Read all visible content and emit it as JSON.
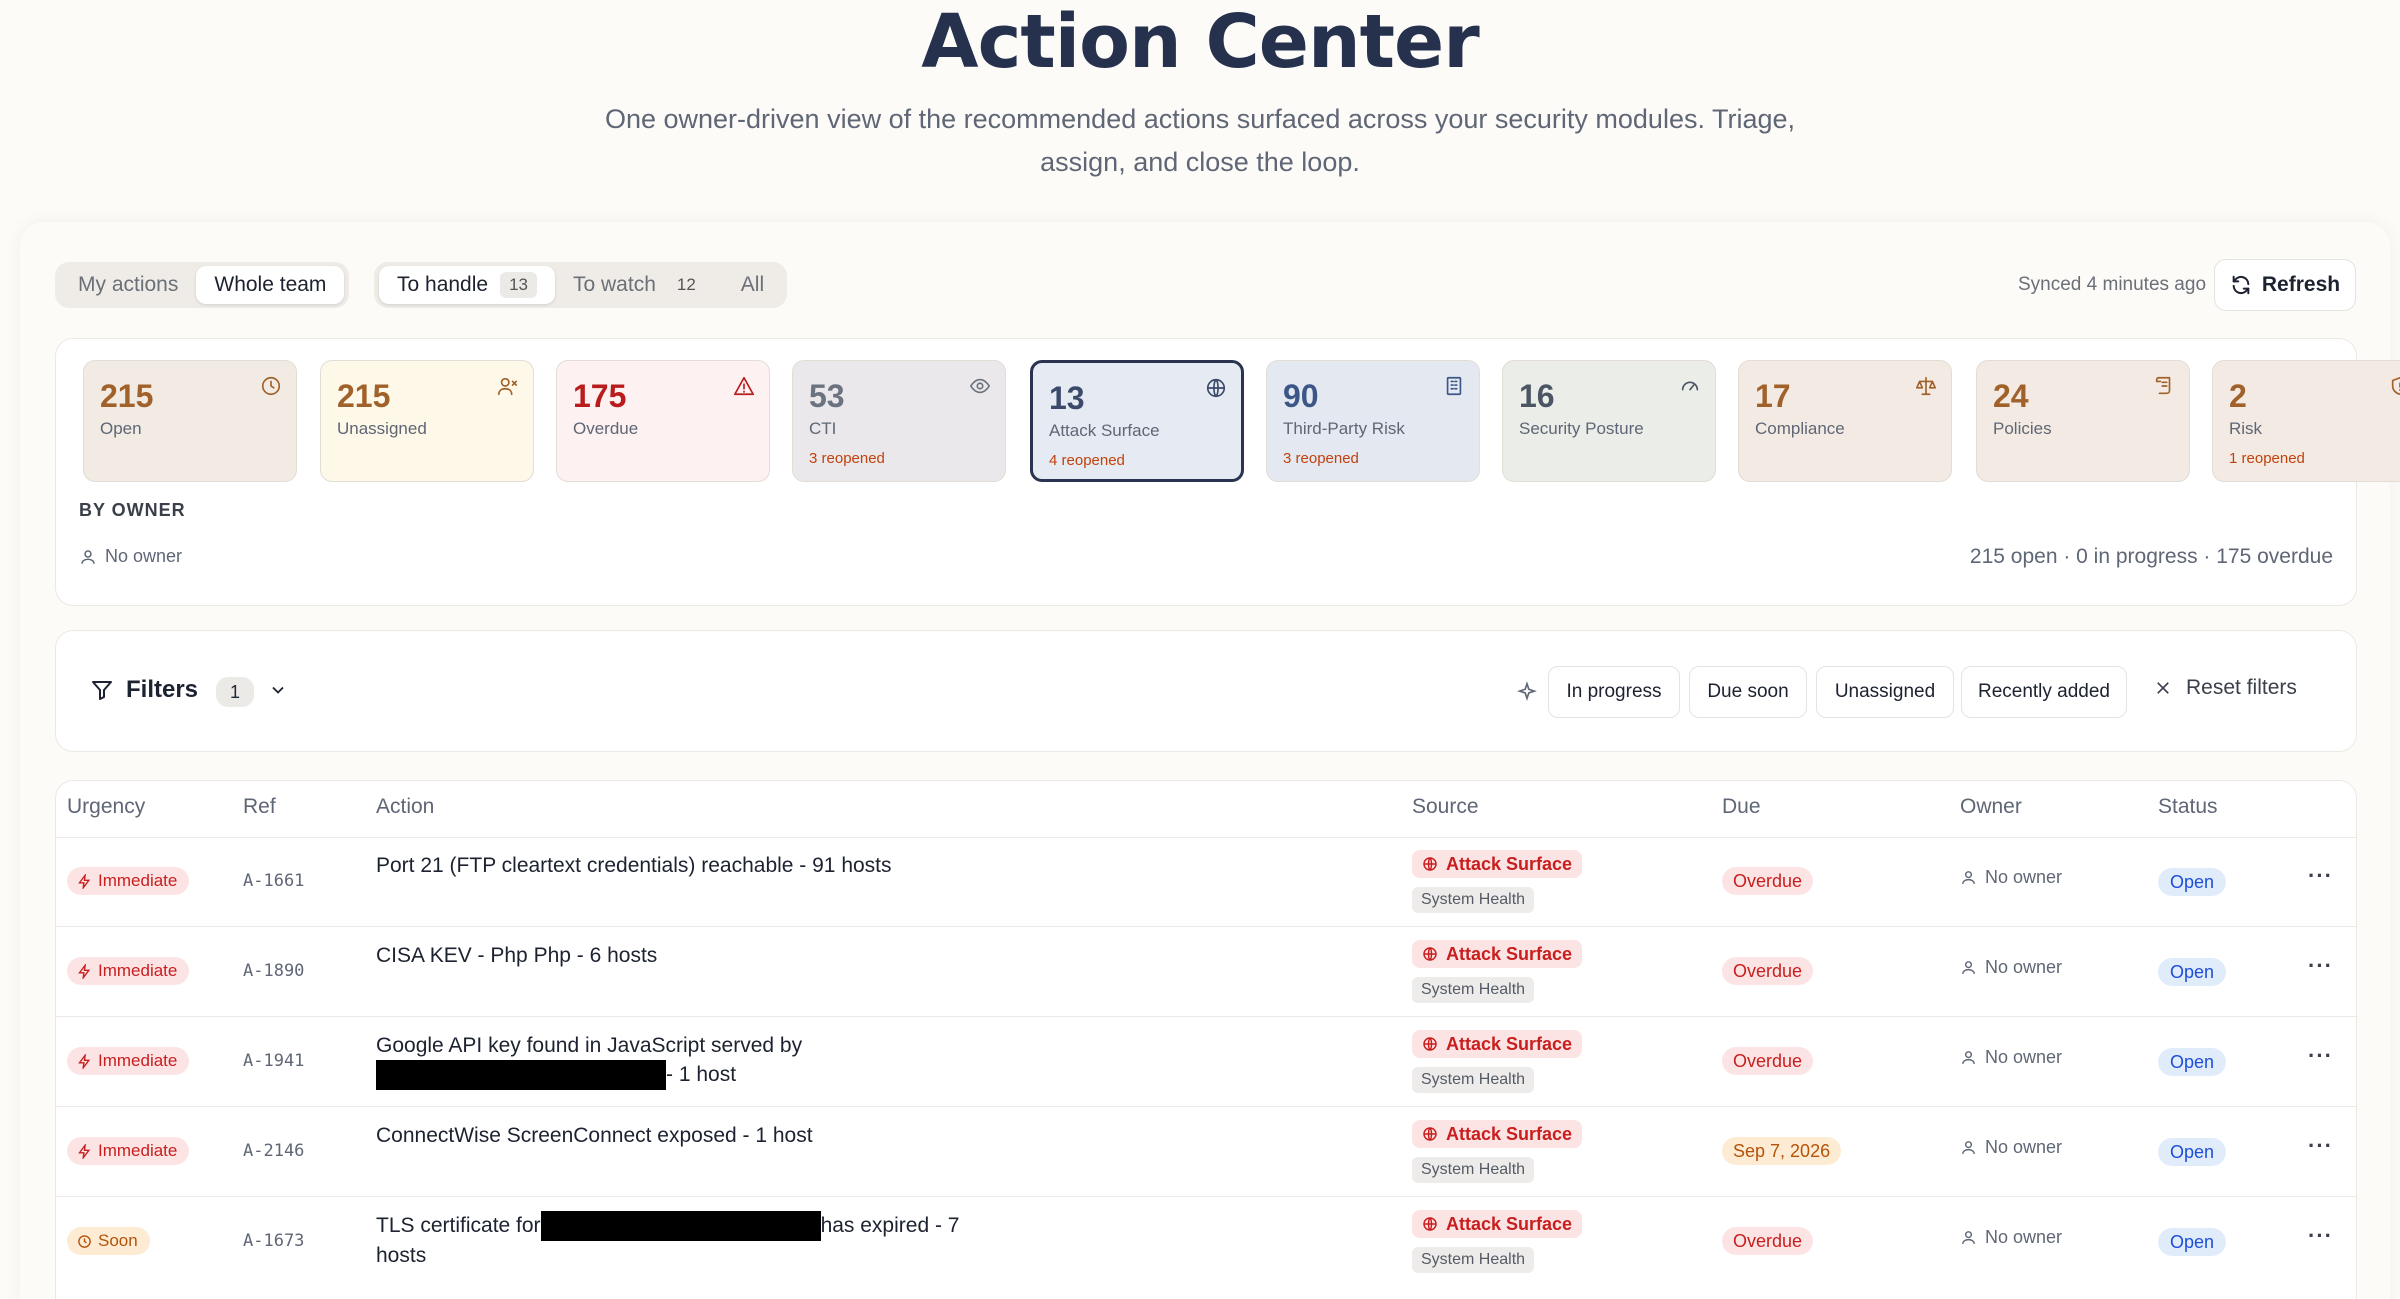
{
  "hero": {
    "title": "Action Center",
    "subtitle": "One owner-driven view of the recommended actions surfaced across your security modules. Triage, assign, and close the loop."
  },
  "toolbar": {
    "scope": [
      {
        "label": "My actions",
        "active": false
      },
      {
        "label": "Whole team",
        "active": true
      }
    ],
    "views": [
      {
        "label": "To handle",
        "count": "13",
        "active": true
      },
      {
        "label": "To watch",
        "count": "12",
        "active": false
      },
      {
        "label": "All",
        "count": "",
        "active": false
      }
    ],
    "synced": "Synced 4 minutes ago",
    "refresh_label": "Refresh"
  },
  "summary": {
    "tiles": [
      {
        "num": "215",
        "label": "Open",
        "sub": "",
        "icon": "clock-icon",
        "color": "#a0612a",
        "bg": "#f1ebe4"
      },
      {
        "num": "215",
        "label": "Unassigned",
        "sub": "",
        "icon": "user-x-icon",
        "color": "#a0612a",
        "bg": "#fdf8e8"
      },
      {
        "num": "175",
        "label": "Overdue",
        "sub": "",
        "icon": "alert-triangle-icon",
        "color": "#b91c1c",
        "bg": "#fdf1f1"
      },
      {
        "num": "53",
        "label": "CTI",
        "sub": "3 reopened",
        "icon": "eye-icon",
        "color": "#6b7280",
        "bg": "#ebe8eb"
      },
      {
        "num": "13",
        "label": "Attack Surface",
        "sub": "4 reopened",
        "icon": "globe-icon",
        "color": "#3b4a6b",
        "bg": "#e6eaf2"
      },
      {
        "num": "90",
        "label": "Third-Party Risk",
        "sub": "3 reopened",
        "icon": "building-icon",
        "color": "#3b5687",
        "bg": "#e4e9f1"
      },
      {
        "num": "16",
        "label": "Security Posture",
        "sub": "",
        "icon": "gauge-icon",
        "color": "#4b5563",
        "bg": "#ebede8"
      },
      {
        "num": "17",
        "label": "Compliance",
        "sub": "",
        "icon": "scale-icon",
        "color": "#a0612a",
        "bg": "#f3ebe3"
      },
      {
        "num": "24",
        "label": "Policies",
        "sub": "",
        "icon": "scroll-icon",
        "color": "#a0612a",
        "bg": "#f3ebe3"
      },
      {
        "num": "2",
        "label": "Risk",
        "sub": "1 reopened",
        "icon": "shield-icon",
        "color": "#a0612a",
        "bg": "#f3ebe3"
      }
    ],
    "by_owner_label": "BY OWNER",
    "no_owner_label": "No owner",
    "totals": "215 open · 0 in progress · 175 overdue"
  },
  "filters": {
    "label": "Filters",
    "count": "1",
    "chips": [
      "In progress",
      "Due soon",
      "Unassigned",
      "Recently added"
    ],
    "reset_label": "Reset filters"
  },
  "table": {
    "headers": [
      "Urgency",
      "Ref",
      "Action",
      "Source",
      "Due",
      "Owner",
      "Status"
    ],
    "rows": [
      {
        "urgency": "Immediate",
        "urgency_type": "immediate",
        "ref": "A-1661",
        "action_a": "Port 21 (FTP cleartext credentials) reachable - 91 hosts",
        "action_b": "",
        "source": "Attack Surface",
        "module": "System Health",
        "due": "Overdue",
        "due_type": "overdue",
        "owner": "No owner",
        "status": "Open"
      },
      {
        "urgency": "Immediate",
        "urgency_type": "immediate",
        "ref": "A-1890",
        "action_a": "CISA KEV - Php Php - 6 hosts",
        "action_b": "",
        "source": "Attack Surface",
        "module": "System Health",
        "due": "Overdue",
        "due_type": "overdue",
        "owner": "No owner",
        "status": "Open"
      },
      {
        "urgency": "Immediate",
        "urgency_type": "immediate",
        "ref": "A-1941",
        "action_a": "Google API key found in JavaScript served by",
        "action_b": "- 1 host",
        "source": "Attack Surface",
        "module": "System Health",
        "due": "Overdue",
        "due_type": "overdue",
        "owner": "No owner",
        "status": "Open"
      },
      {
        "urgency": "Immediate",
        "urgency_type": "immediate",
        "ref": "A-2146",
        "action_a": "ConnectWise ScreenConnect exposed - 1 host",
        "action_b": "",
        "source": "Attack Surface",
        "module": "System Health",
        "due": "Sep 7, 2026",
        "due_type": "date",
        "owner": "No owner",
        "status": "Open"
      },
      {
        "urgency": "Soon",
        "urgency_type": "soon",
        "ref": "A-1673",
        "action_a": "TLS certificate for",
        "action_b": "has expired - 7 hosts",
        "source": "Attack Surface",
        "module": "System Health",
        "due": "Overdue",
        "due_type": "overdue",
        "owner": "No owner",
        "status": "Open"
      }
    ]
  }
}
